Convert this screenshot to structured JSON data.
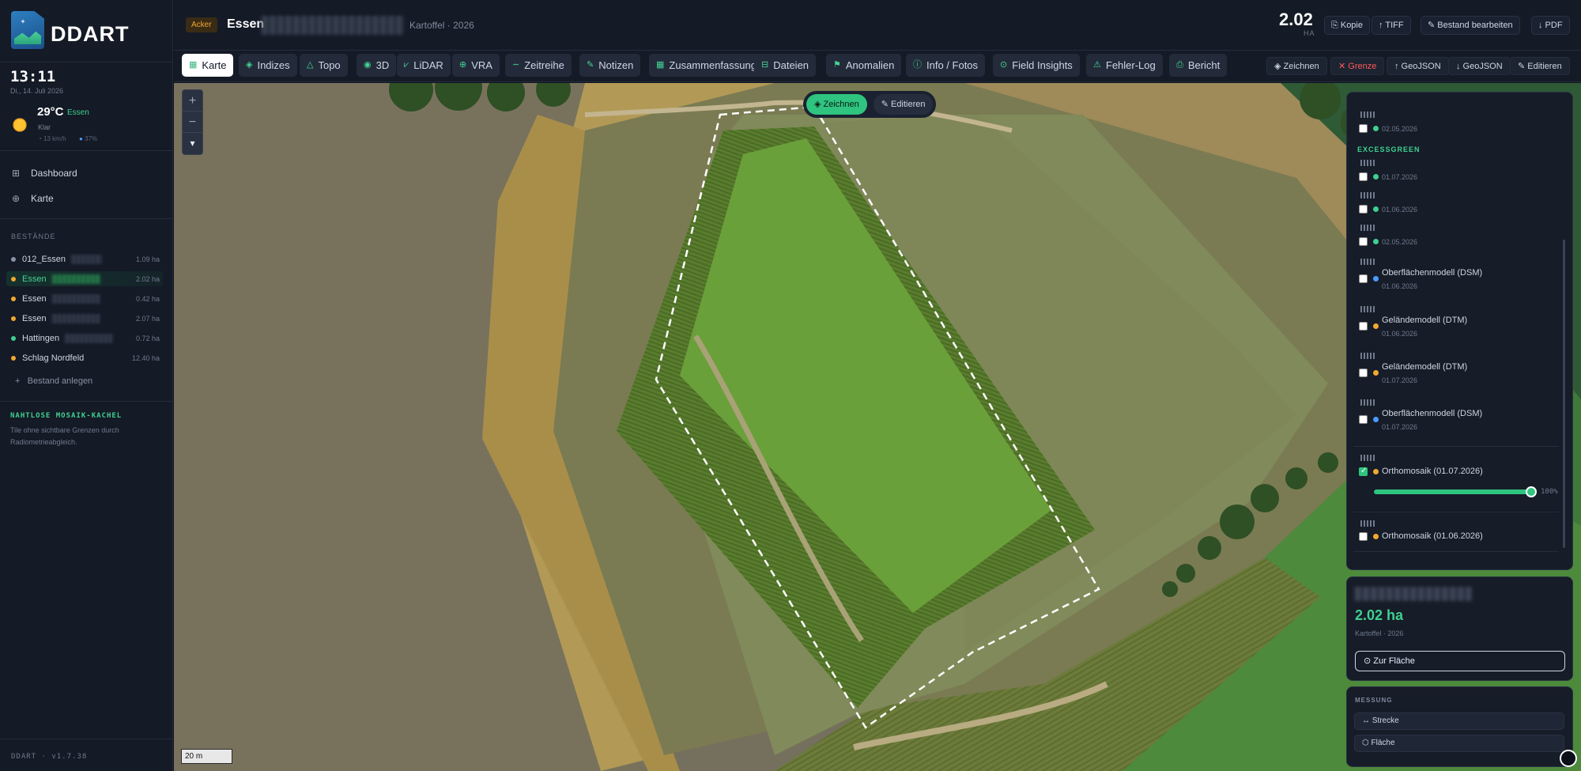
{
  "app": {
    "name": "DDART",
    "version": "DDART · v1.7.38"
  },
  "sidebar": {
    "clock": "13:11",
    "date": "Di., 14. Juli 2026",
    "weather": {
      "temp": "29°C",
      "city": "Essen",
      "condition": "Klar",
      "wind": "13 km/h",
      "humidity": "37%"
    },
    "nav": [
      {
        "label": "Dashboard",
        "icon": "grid-icon"
      },
      {
        "label": "Karte",
        "icon": "globe-icon"
      }
    ],
    "stands_label": "BESTÄNDE",
    "stands": [
      {
        "name": "012_Essen",
        "ha": "1.09 ha",
        "dot": "#8893a5"
      },
      {
        "name": "Essen",
        "ha": "2.02 ha",
        "dot": "#f0a830"
      },
      {
        "name": "Essen",
        "ha": "0.42 ha",
        "dot": "#f0a830"
      },
      {
        "name": "Essen",
        "ha": "2.07 ha",
        "dot": "#f0a830"
      },
      {
        "name": "Hattingen",
        "ha": "0.72 ha",
        "dot": "#3fd08f"
      },
      {
        "name": "Schlag Nordfeld",
        "ha": "12.40 ha",
        "dot": "#f0a830"
      }
    ],
    "add_stand": "Bestand anlegen",
    "mosaic_title": "NAHTLOSE MOSAIK-KACHEL",
    "mosaic_desc": "Tile ohne sichtbare Grenzen durch Radiometrieabgleich."
  },
  "header": {
    "badge": "Acker",
    "field_name": "Essen",
    "crop": "Kartoffel · 2026",
    "area": "2.02",
    "area_unit": "HA",
    "buttons": [
      "⎘ Kopie",
      "↑ TIFF",
      "✎ Bestand bearbeiten",
      "↓ PDF"
    ]
  },
  "tabs": [
    {
      "label": "Karte",
      "icon": "▦"
    },
    {
      "label": "Indizes",
      "icon": "◈"
    },
    {
      "label": "Topo",
      "icon": "△"
    },
    {
      "label": "3D",
      "icon": "◉"
    },
    {
      "label": "LiDAR",
      "icon": "⩗"
    },
    {
      "label": "VRA",
      "icon": "⊕"
    },
    {
      "label": "Zeitreihe",
      "icon": "∼"
    },
    {
      "label": "Notizen",
      "icon": "✎"
    },
    {
      "label": "Zusammenfassung",
      "icon": "▦"
    },
    {
      "label": "Dateien",
      "icon": "⊟"
    },
    {
      "label": "Anomalien",
      "icon": "⚑"
    },
    {
      "label": "Info / Fotos",
      "icon": "ⓘ"
    },
    {
      "label": "Field Insights",
      "icon": "⊙"
    },
    {
      "label": "Fehler-Log",
      "icon": "⚠"
    },
    {
      "label": "Bericht",
      "icon": "⎙"
    }
  ],
  "tools": [
    "◈ Zeichnen",
    "✕ Grenze",
    "↑ GeoJSON",
    "↓ GeoJSON",
    "✎ Editieren"
  ],
  "map": {
    "draw_buttons": [
      "◈ Zeichnen",
      "✎ Editieren"
    ],
    "scale": "20 m"
  },
  "layers": {
    "section": "EXCESSGREEN",
    "top_date": "02.05.2026",
    "items": [
      {
        "date": "01.07.2026",
        "dot": "#3fd08f"
      },
      {
        "date": "01.06.2026",
        "dot": "#3fd08f"
      },
      {
        "date": "02.05.2026",
        "dot": "#3fd08f"
      }
    ],
    "models": [
      {
        "name": "Oberflächenmodell (DSM)",
        "date": "01.06.2026",
        "dot": "#4a9bff"
      },
      {
        "name": "Geländemodell (DTM)",
        "date": "01.06.2026",
        "dot": "#f0a830"
      },
      {
        "name": "Geländemodell (DTM)",
        "date": "01.07.2026",
        "dot": "#f0a830"
      },
      {
        "name": "Oberflächenmodell (DSM)",
        "date": "01.07.2026",
        "dot": "#4a9bff"
      }
    ],
    "ortho_active": "Orthomosaik (01.07.2026)",
    "opacity": "100%",
    "ortho_other": "Orthomosaik (01.06.2026)"
  },
  "info": {
    "area": "2.02 ha",
    "crop": "Kartoffel · 2026",
    "button": "⊙ Zur Fläche"
  },
  "measure": {
    "label": "MESSUNG",
    "buttons": [
      "↔ Strecke",
      "⬡ Fläche"
    ]
  }
}
